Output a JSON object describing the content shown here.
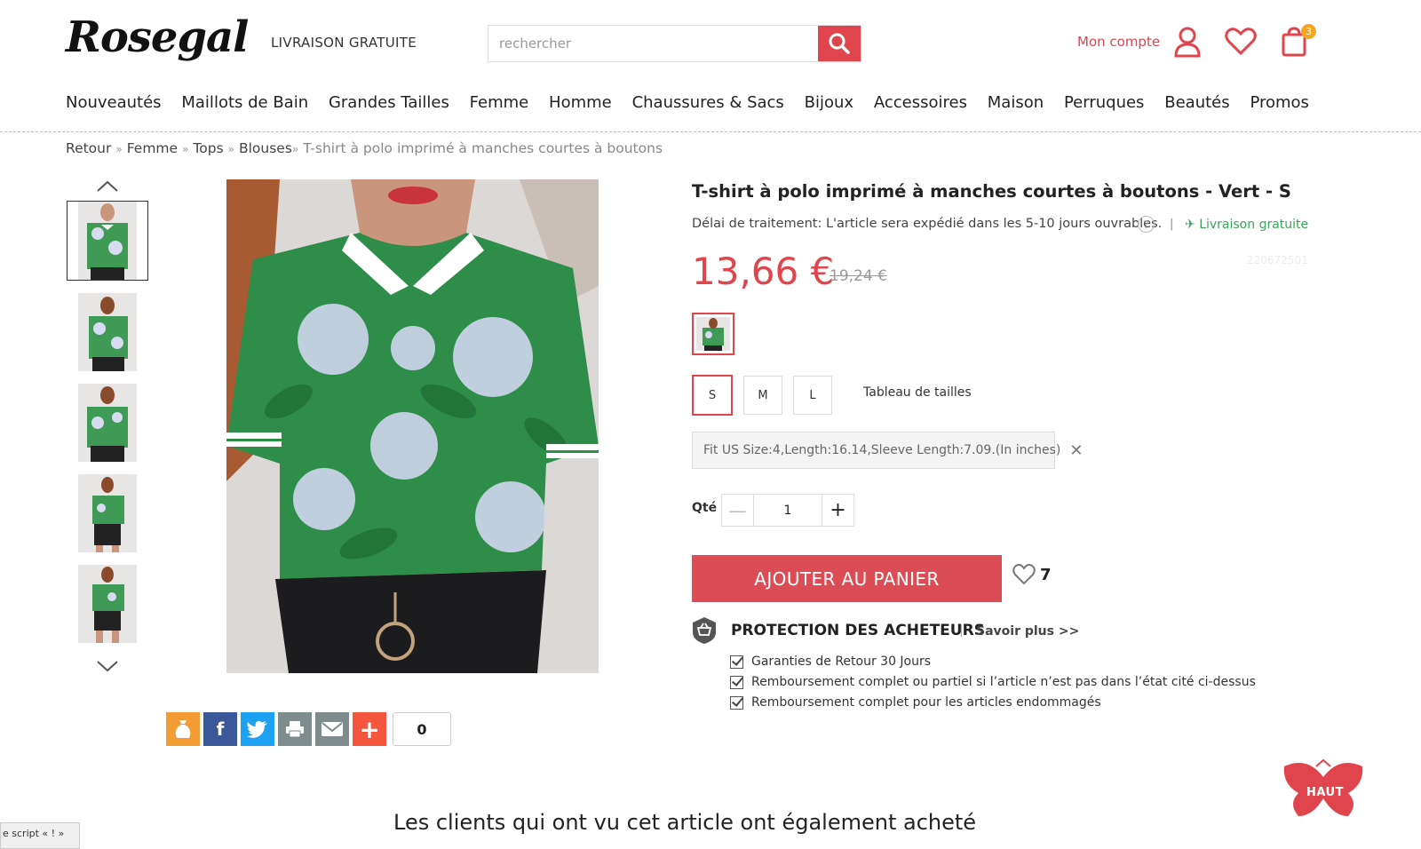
{
  "header": {
    "logo_text": "Rosegal",
    "tagline": "LIVRAISON GRATUITE",
    "search_placeholder": "rechercher",
    "account_label": "Mon compte",
    "cart_count": "3"
  },
  "nav": {
    "items": [
      "Nouveautés",
      "Maillots de Bain",
      "Grandes Tailles",
      "Femme",
      "Homme",
      "Chaussures & Sacs",
      "Bijoux",
      "Accessoires",
      "Maison",
      "Perruques",
      "Beautés",
      "Promos"
    ]
  },
  "breadcrumb": {
    "items": [
      "Retour",
      "Femme",
      "Tops",
      "Blouses"
    ],
    "current": "T-shirt à polo imprimé à manches courtes à boutons",
    "separator": "»"
  },
  "product": {
    "title": "T-shirt à polo imprimé à manches courtes à boutons - Vert - S",
    "delay_text": "Délai de traitement: L'article sera expédié dans les 5-10 jours ouvrables.",
    "free_shipping": "Livraison gratuite",
    "sku": "220672501",
    "price": "13,66 €",
    "old_price": "19,24 €",
    "sizes": [
      "S",
      "M",
      "L"
    ],
    "selected_size": "S",
    "size_chart_label": "Tableau de tailles",
    "fit_info": "Fit US Size:4,Length:16.14,Sleeve Length:7.09.(In inches)",
    "qty_label": "Qté",
    "qty_value": "1",
    "add_to_cart": "AJOUTER AU PANIER",
    "favorites_count": "7",
    "protection_title": "PROTECTION DES ACHETEURS",
    "protection_more": "Savoir plus >>",
    "guarantees": [
      "Garanties de Retour 30 Jours",
      "Remboursement complet ou partiel si l’article n’est pas dans l’état cité ci-dessus",
      "Remboursement complet pour les articles endommagés"
    ]
  },
  "share": {
    "count": "0"
  },
  "back_to_top": "HAUT",
  "section_title": "Les clients qui ont vu cet article ont également acheté",
  "script_label": "e script « ! »",
  "colors": {
    "accent": "#e0444c",
    "green": "#3aa55a",
    "badge": "#f5a623"
  }
}
